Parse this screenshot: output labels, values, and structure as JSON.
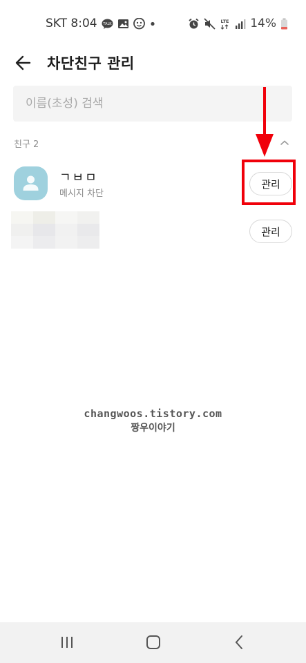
{
  "status_bar": {
    "carrier_time": "SKT 8:04",
    "network": "LTE",
    "battery": "14%",
    "icons_left": [
      "talk-icon",
      "gallery-icon",
      "location-icon",
      "dot-icon"
    ],
    "icons_right": [
      "alarm-icon",
      "mute-icon",
      "lte-icon",
      "signal-icon",
      "battery-icon"
    ]
  },
  "header": {
    "title": "차단친구 관리"
  },
  "search": {
    "placeholder": "이름(초성) 검색"
  },
  "section": {
    "title": "친구 2"
  },
  "friends": [
    {
      "name": "ㄱㅂㅁ",
      "status": "메시지 차단",
      "button_label": "관리"
    },
    {
      "name": "",
      "status": "",
      "button_label": "관리"
    }
  ],
  "watermark": {
    "line1": "changwoos.tistory.com",
    "line2": "짱우이야기"
  },
  "colors": {
    "avatar": "#9fd1de",
    "highlight": "#f0000a",
    "navbar": "#f2f2f2"
  }
}
